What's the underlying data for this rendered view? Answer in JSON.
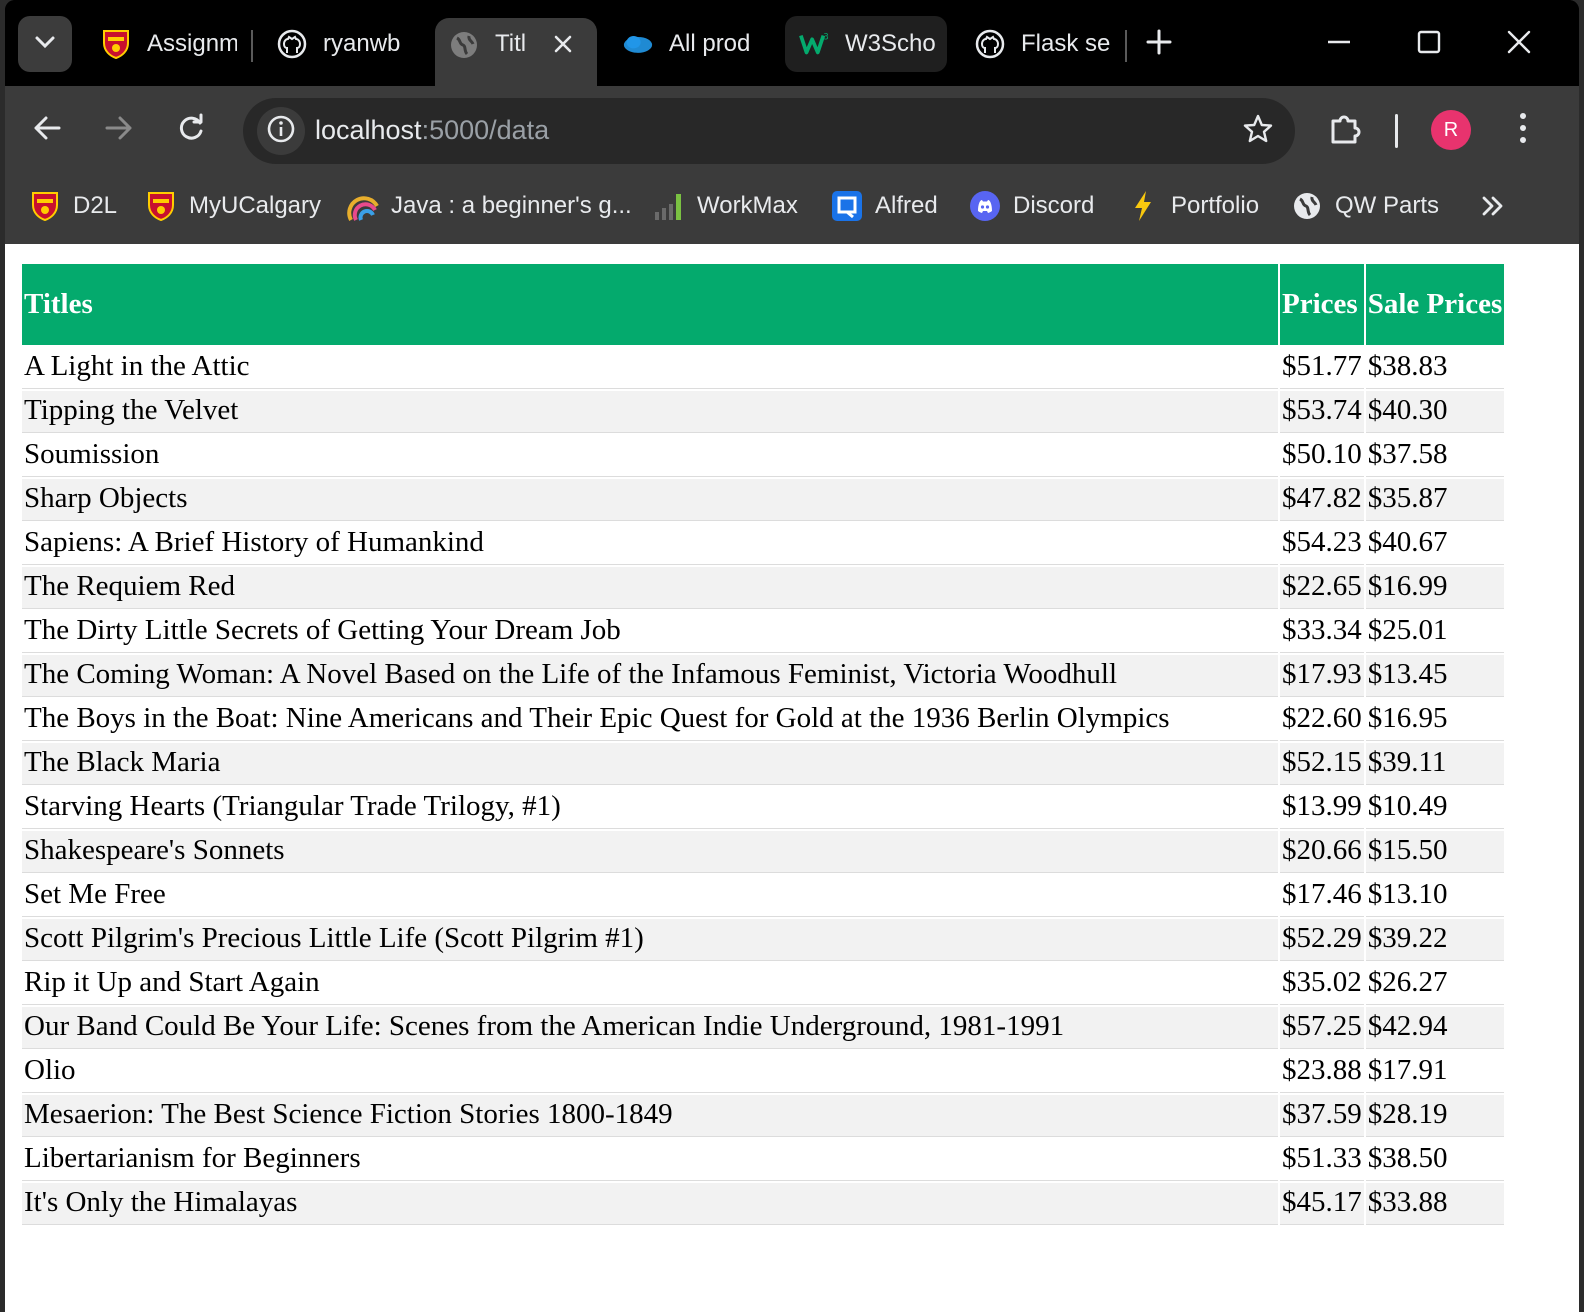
{
  "browser": {
    "tabs": [
      {
        "label": "Assignm",
        "icon": "university-crest-icon"
      },
      {
        "label": "ryanwb",
        "icon": "github-icon"
      },
      {
        "label": "Titl",
        "icon": "globe-icon",
        "active": true
      },
      {
        "label": "All prod",
        "icon": "cloud-icon"
      },
      {
        "label": "W3Scho",
        "icon": "w3schools-icon"
      },
      {
        "label": "Flask se",
        "icon": "github-icon"
      }
    ],
    "url_host": "localhost",
    "url_path": ":5000/data",
    "profile_initial": "R",
    "bookmarks": [
      {
        "label": "D2L",
        "icon": "university-crest-icon"
      },
      {
        "label": "MyUCalgary",
        "icon": "university-crest-icon"
      },
      {
        "label": "Java : a beginner's g...",
        "icon": "rainbow-icon"
      },
      {
        "label": "WorkMax",
        "icon": "bar-chart-icon"
      },
      {
        "label": "Alfred",
        "icon": "alfred-icon"
      },
      {
        "label": "Discord",
        "icon": "discord-icon"
      },
      {
        "label": "Portfolio",
        "icon": "lightning-icon"
      },
      {
        "label": "QW Parts",
        "icon": "globe-icon"
      }
    ]
  },
  "table": {
    "headers": [
      "Titles",
      "Prices",
      "Sale Prices"
    ],
    "rows": [
      [
        "A Light in the Attic",
        "$51.77",
        "$38.83"
      ],
      [
        "Tipping the Velvet",
        "$53.74",
        "$40.30"
      ],
      [
        "Soumission",
        "$50.10",
        "$37.58"
      ],
      [
        "Sharp Objects",
        "$47.82",
        "$35.87"
      ],
      [
        "Sapiens: A Brief History of Humankind",
        "$54.23",
        "$40.67"
      ],
      [
        "The Requiem Red",
        "$22.65",
        "$16.99"
      ],
      [
        "The Dirty Little Secrets of Getting Your Dream Job",
        "$33.34",
        "$25.01"
      ],
      [
        "The Coming Woman: A Novel Based on the Life of the Infamous Feminist, Victoria Woodhull",
        "$17.93",
        "$13.45"
      ],
      [
        "The Boys in the Boat: Nine Americans and Their Epic Quest for Gold at the 1936 Berlin Olympics",
        "$22.60",
        "$16.95"
      ],
      [
        "The Black Maria",
        "$52.15",
        "$39.11"
      ],
      [
        "Starving Hearts (Triangular Trade Trilogy, #1)",
        "$13.99",
        "$10.49"
      ],
      [
        "Shakespeare's Sonnets",
        "$20.66",
        "$15.50"
      ],
      [
        "Set Me Free",
        "$17.46",
        "$13.10"
      ],
      [
        "Scott Pilgrim's Precious Little Life (Scott Pilgrim #1)",
        "$52.29",
        "$39.22"
      ],
      [
        "Rip it Up and Start Again",
        "$35.02",
        "$26.27"
      ],
      [
        "Our Band Could Be Your Life: Scenes from the American Indie Underground, 1981-1991",
        "$57.25",
        "$42.94"
      ],
      [
        "Olio",
        "$23.88",
        "$17.91"
      ],
      [
        "Mesaerion: The Best Science Fiction Stories 1800-1849",
        "$37.59",
        "$28.19"
      ],
      [
        "Libertarianism for Beginners",
        "$51.33",
        "$38.50"
      ],
      [
        "It's Only the Himalayas",
        "$45.17",
        "$33.88"
      ]
    ]
  },
  "colors": {
    "header_bg": "#04aa6d",
    "stripe": "#f2f2f2",
    "profile": "#e8336e"
  }
}
